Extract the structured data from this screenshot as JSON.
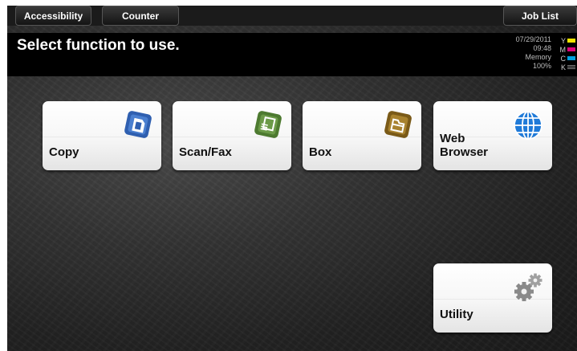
{
  "topbar": {
    "accessibility_label": "Accessibility",
    "counter_label": "Counter",
    "job_list_label": "Job List"
  },
  "message": {
    "text": "Select function to use."
  },
  "status": {
    "date": "07/29/2011",
    "time": "09:48",
    "memory_label": "Memory",
    "memory_value": "100%"
  },
  "toner": [
    {
      "letter": "Y",
      "color": "#f2e400"
    },
    {
      "letter": "M",
      "color": "#e0007a"
    },
    {
      "letter": "C",
      "color": "#00a0e0"
    },
    {
      "letter": "K",
      "color": "#111111"
    }
  ],
  "functions": {
    "copy": {
      "label": "Copy",
      "icon": "copy-icon"
    },
    "scan_fax": {
      "label": "Scan/Fax",
      "icon": "scan-fax-icon"
    },
    "box": {
      "label": "Box",
      "icon": "box-icon"
    },
    "web_browser": {
      "label_line1": "Web",
      "label_line2": "Browser",
      "icon": "globe-icon"
    },
    "utility": {
      "label": "Utility",
      "icon": "gears-icon"
    }
  },
  "colors": {
    "copy_icon": "#2f5fb0",
    "scan_icon": "#5a8a3a",
    "box_icon": "#8a6a20",
    "web_icon": "#1f7ad8",
    "utility_icon": "#888888"
  }
}
